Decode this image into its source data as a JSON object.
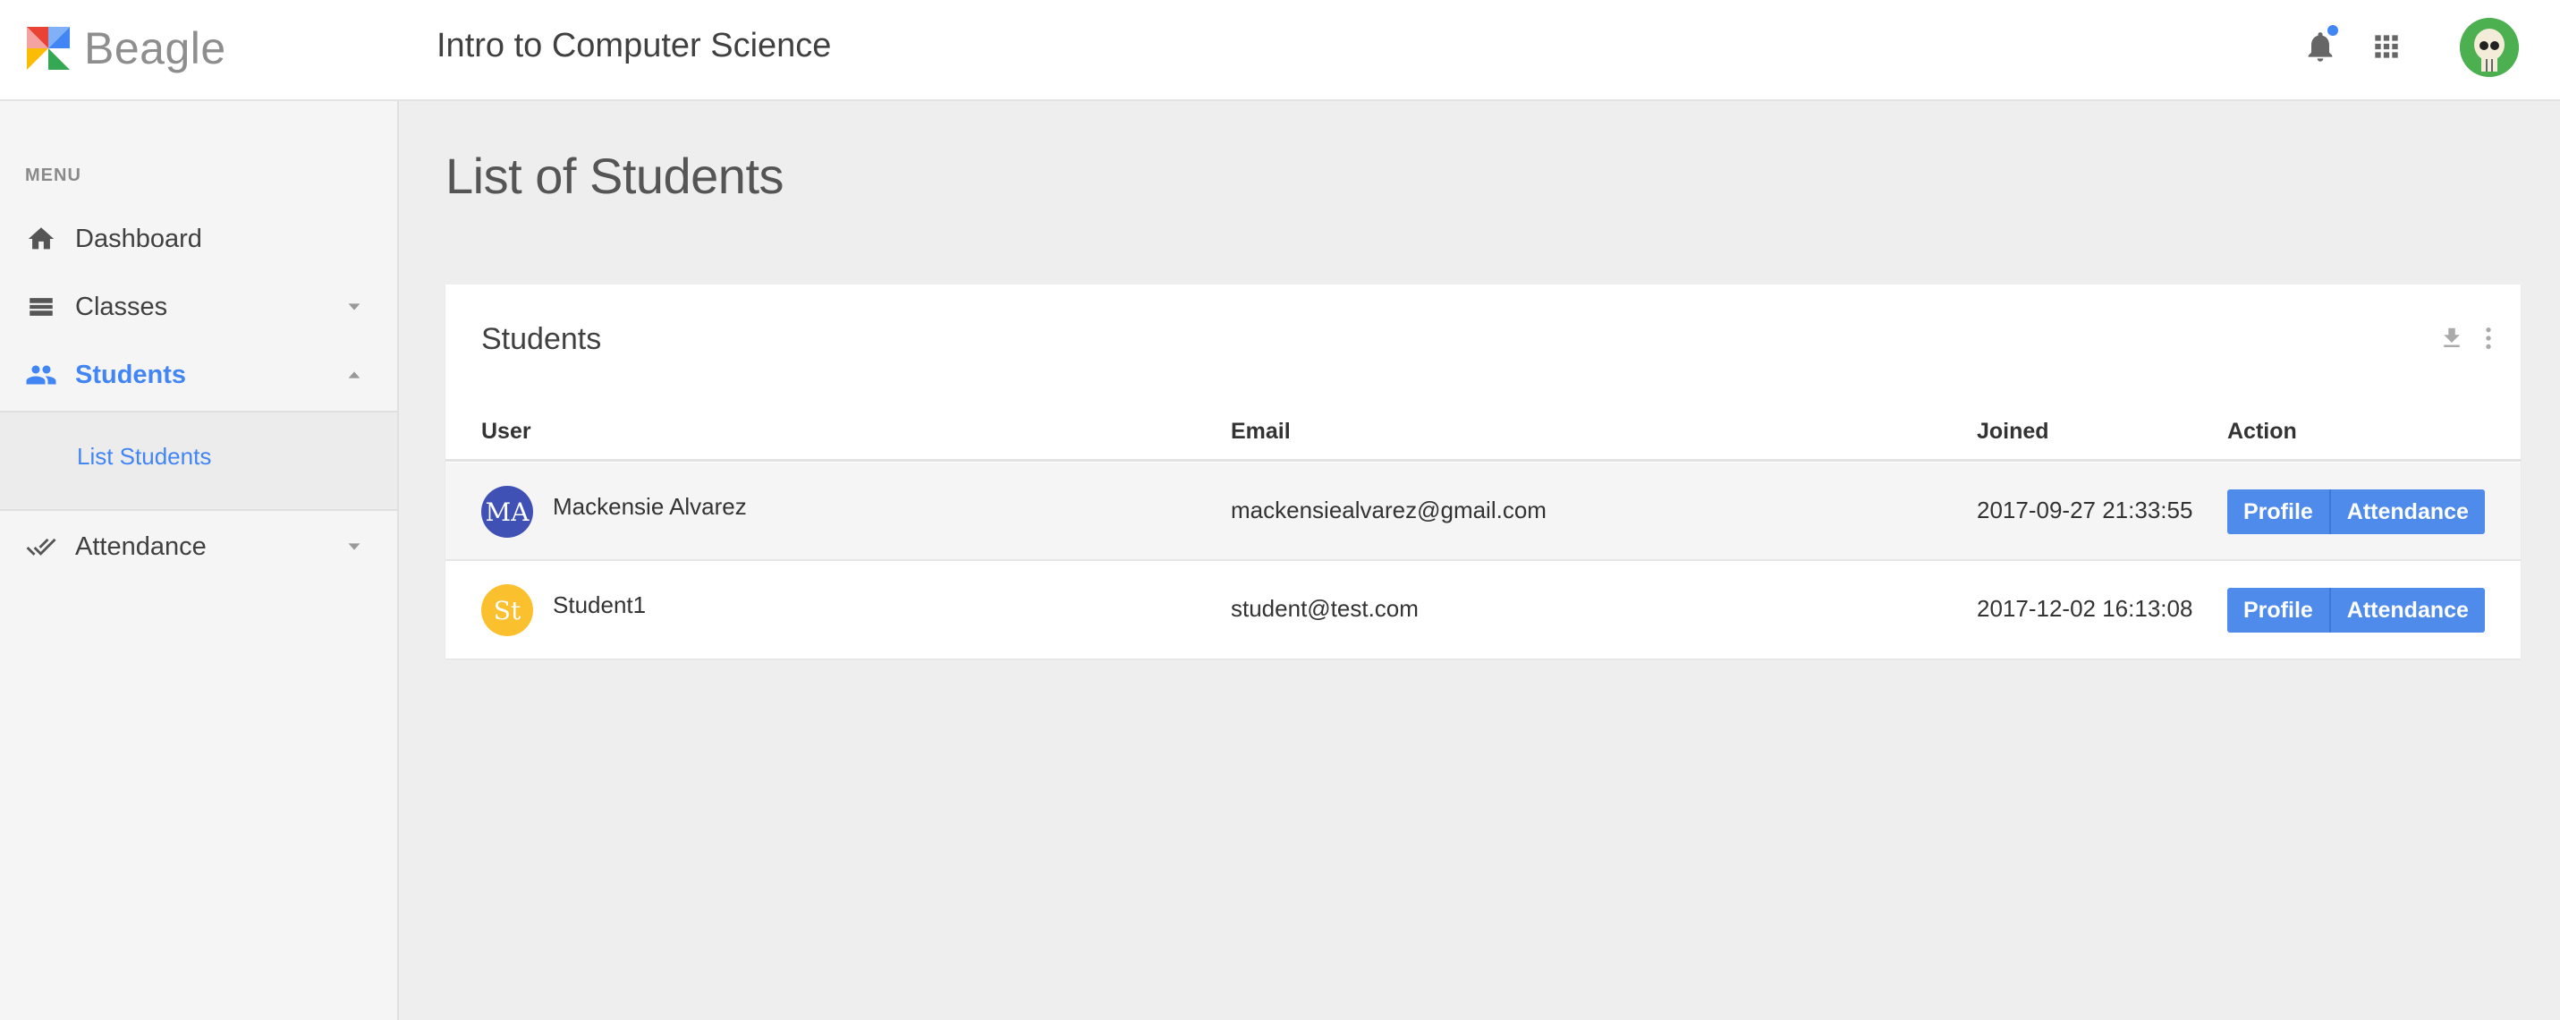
{
  "app": {
    "name": "Beagle"
  },
  "header": {
    "course_title": "Intro to Computer Science",
    "notification_badge_color": "#4285f4"
  },
  "sidebar": {
    "menu_heading": "MENU",
    "items": [
      {
        "label": "Dashboard",
        "icon": "home-icon"
      },
      {
        "label": "Classes",
        "icon": "list-icon"
      },
      {
        "label": "Students",
        "icon": "people-icon",
        "active": true
      },
      {
        "label": "Attendance",
        "icon": "double-check-icon"
      }
    ],
    "submenu": {
      "list_students": "List Students"
    }
  },
  "main": {
    "page_title": "List of Students",
    "card": {
      "title": "Students",
      "columns": [
        "User",
        "Email",
        "Joined",
        "Action"
      ],
      "rows": [
        {
          "initials": "MA",
          "avatar_color": "#3f51b5",
          "name": "Mackensie Alvarez",
          "email": "mackensiealvarez@gmail.com",
          "joined": "2017-09-27 21:33:55"
        },
        {
          "initials": "St",
          "avatar_color": "#fbc02d",
          "name": "Student1",
          "email": "student@test.com",
          "joined": "2017-12-02 16:13:08"
        }
      ],
      "actions": {
        "profile": "Profile",
        "attendance": "Attendance"
      }
    }
  },
  "colors": {
    "accent": "#4285f4",
    "button": "#4f8bea"
  }
}
